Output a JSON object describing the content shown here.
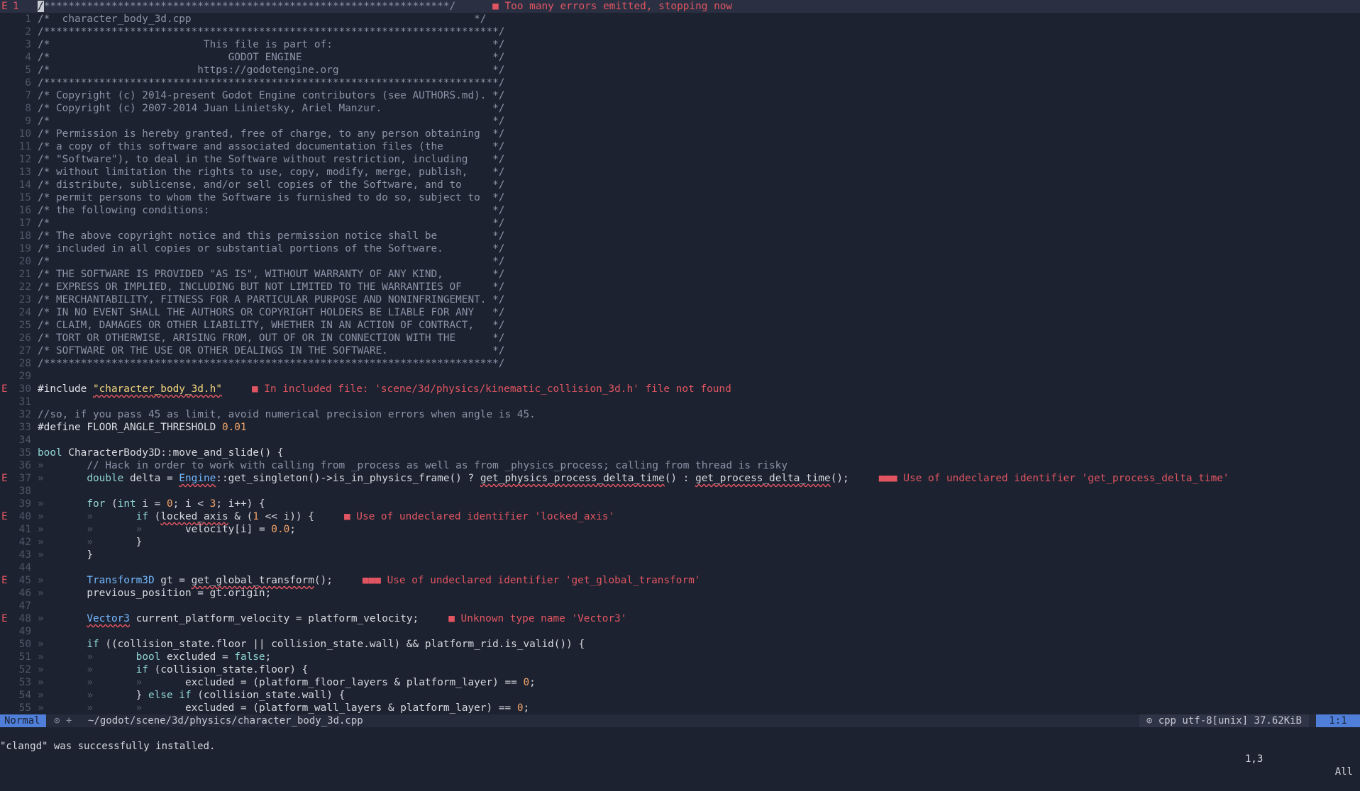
{
  "editor": {
    "lines": [
      {
        "n": "1",
        "sign": "E",
        "current": true,
        "cursor": "/",
        "code": "******************************************************************/",
        "diag": "Too many errors emitted, stopping now",
        "diag_gap": 52
      },
      {
        "n": "1",
        "code": "/*  character_body_3d.cpp                                              */"
      },
      {
        "n": "2",
        "code": "/**************************************************************************/"
      },
      {
        "n": "3",
        "code": "/*                         This file is part of:                          */"
      },
      {
        "n": "4",
        "code": "/*                             GODOT ENGINE                               */"
      },
      {
        "n": "5",
        "code": "/*                        https://godotengine.org                         */"
      },
      {
        "n": "6",
        "code": "/**************************************************************************/"
      },
      {
        "n": "7",
        "code": "/* Copyright (c) 2014-present Godot Engine contributors (see AUTHORS.md). */"
      },
      {
        "n": "8",
        "code": "/* Copyright (c) 2007-2014 Juan Linietsky, Ariel Manzur.                  */"
      },
      {
        "n": "9",
        "code": "/*                                                                        */"
      },
      {
        "n": "10",
        "code": "/* Permission is hereby granted, free of charge, to any person obtaining  */"
      },
      {
        "n": "11",
        "code": "/* a copy of this software and associated documentation files (the        */"
      },
      {
        "n": "12",
        "code": "/* \"Software\"), to deal in the Software without restriction, including    */"
      },
      {
        "n": "13",
        "code": "/* without limitation the rights to use, copy, modify, merge, publish,    */"
      },
      {
        "n": "14",
        "code": "/* distribute, sublicense, and/or sell copies of the Software, and to     */"
      },
      {
        "n": "15",
        "code": "/* permit persons to whom the Software is furnished to do so, subject to  */"
      },
      {
        "n": "16",
        "code": "/* the following conditions:                                              */"
      },
      {
        "n": "17",
        "code": "/*                                                                        */"
      },
      {
        "n": "18",
        "code": "/* The above copyright notice and this permission notice shall be         */"
      },
      {
        "n": "19",
        "code": "/* included in all copies or substantial portions of the Software.        */"
      },
      {
        "n": "20",
        "code": "/*                                                                        */"
      },
      {
        "n": "21",
        "code": "/* THE SOFTWARE IS PROVIDED \"AS IS\", WITHOUT WARRANTY OF ANY KIND,        */"
      },
      {
        "n": "22",
        "code": "/* EXPRESS OR IMPLIED, INCLUDING BUT NOT LIMITED TO THE WARRANTIES OF     */"
      },
      {
        "n": "23",
        "code": "/* MERCHANTABILITY, FITNESS FOR A PARTICULAR PURPOSE AND NONINFRINGEMENT. */"
      },
      {
        "n": "24",
        "code": "/* IN NO EVENT SHALL THE AUTHORS OR COPYRIGHT HOLDERS BE LIABLE FOR ANY   */"
      },
      {
        "n": "25",
        "code": "/* CLAIM, DAMAGES OR OTHER LIABILITY, WHETHER IN AN ACTION OF CONTRACT,   */"
      },
      {
        "n": "26",
        "code": "/* TORT OR OTHERWISE, ARISING FROM, OUT OF OR IN CONNECTION WITH THE      */"
      },
      {
        "n": "27",
        "code": "/* SOFTWARE OR THE USE OR OTHER DEALINGS IN THE SOFTWARE.                 */"
      },
      {
        "n": "28",
        "code": "/**************************************************************************/"
      },
      {
        "n": "29",
        "code": ""
      },
      {
        "n": "30",
        "sign": "E",
        "code": "#include \"character_body_3d.h\"",
        "diag": "In included file: 'scene/3d/physics/kinematic_collision_3d.h' file not found"
      },
      {
        "n": "31",
        "code": ""
      },
      {
        "n": "32",
        "code": "//so, if you pass 45 as limit, avoid numerical precision errors when angle is 45."
      },
      {
        "n": "33",
        "code": "#define FLOOR_ANGLE_THRESHOLD 0.01"
      },
      {
        "n": "34",
        "code": ""
      },
      {
        "n": "35",
        "code": "bool CharacterBody3D::move_and_slide() {"
      },
      {
        "n": "36",
        "code": "»       // Hack in order to work with calling from _process as well as from _physics_process; calling from thread is risky"
      },
      {
        "n": "37",
        "sign": "E",
        "code": "»       double delta = Engine::get_singleton()->is_in_physics_frame() ? get_physics_process_delta_time() : get_process_delta_time();",
        "diag": "Use of undeclared identifier 'get_process_delta_time'",
        "multi": true
      },
      {
        "n": "38",
        "code": ""
      },
      {
        "n": "39",
        "code": "»       for (int i = 0; i < 3; i++) {"
      },
      {
        "n": "40",
        "sign": "E",
        "code": "»       »       if (locked_axis & (1 << i)) {",
        "diag": "Use of undeclared identifier 'locked_axis'"
      },
      {
        "n": "41",
        "code": "»       »       »       velocity[i] = 0.0;"
      },
      {
        "n": "42",
        "code": "»       »       }"
      },
      {
        "n": "43",
        "code": "»       }"
      },
      {
        "n": "44",
        "code": ""
      },
      {
        "n": "45",
        "sign": "E",
        "code": "»       Transform3D gt = get_global_transform();",
        "diag": "Use of undeclared identifier 'get_global_transform'",
        "multi": true
      },
      {
        "n": "46",
        "code": "»       previous_position = gt.origin;"
      },
      {
        "n": "47",
        "code": ""
      },
      {
        "n": "48",
        "sign": "E",
        "code": "»       Vector3 current_platform_velocity = platform_velocity;",
        "diag": "Unknown type name 'Vector3'"
      },
      {
        "n": "49",
        "code": ""
      },
      {
        "n": "50",
        "code": "»       if ((collision_state.floor || collision_state.wall) && platform_rid.is_valid()) {"
      },
      {
        "n": "51",
        "code": "»       »       bool excluded = false;"
      },
      {
        "n": "52",
        "code": "»       »       if (collision_state.floor) {"
      },
      {
        "n": "53",
        "code": "»       »       »       excluded = (platform_floor_layers & platform_layer) == 0;"
      },
      {
        "n": "54",
        "code": "»       »       } else if (collision_state.wall) {"
      },
      {
        "n": "55",
        "code": "»       »       »       excluded = (platform_wall_layers & platform_layer) == 0;"
      }
    ]
  },
  "statusline": {
    "mode": "Normal",
    "git": "⊙ +",
    "path": "~/godot/scene/3d/physics/character_body_3d.cpp",
    "fileinfo": "⊙ cpp utf-8[unix] 37.62KiB",
    "position": "1:1"
  },
  "cmdline": {
    "message": "\"clangd\" was successfully installed.",
    "ruler": "1,3",
    "percent": "All"
  },
  "colors": {
    "background": "#1d2230",
    "error": "#e05561",
    "accent": "#4f7fd9"
  }
}
